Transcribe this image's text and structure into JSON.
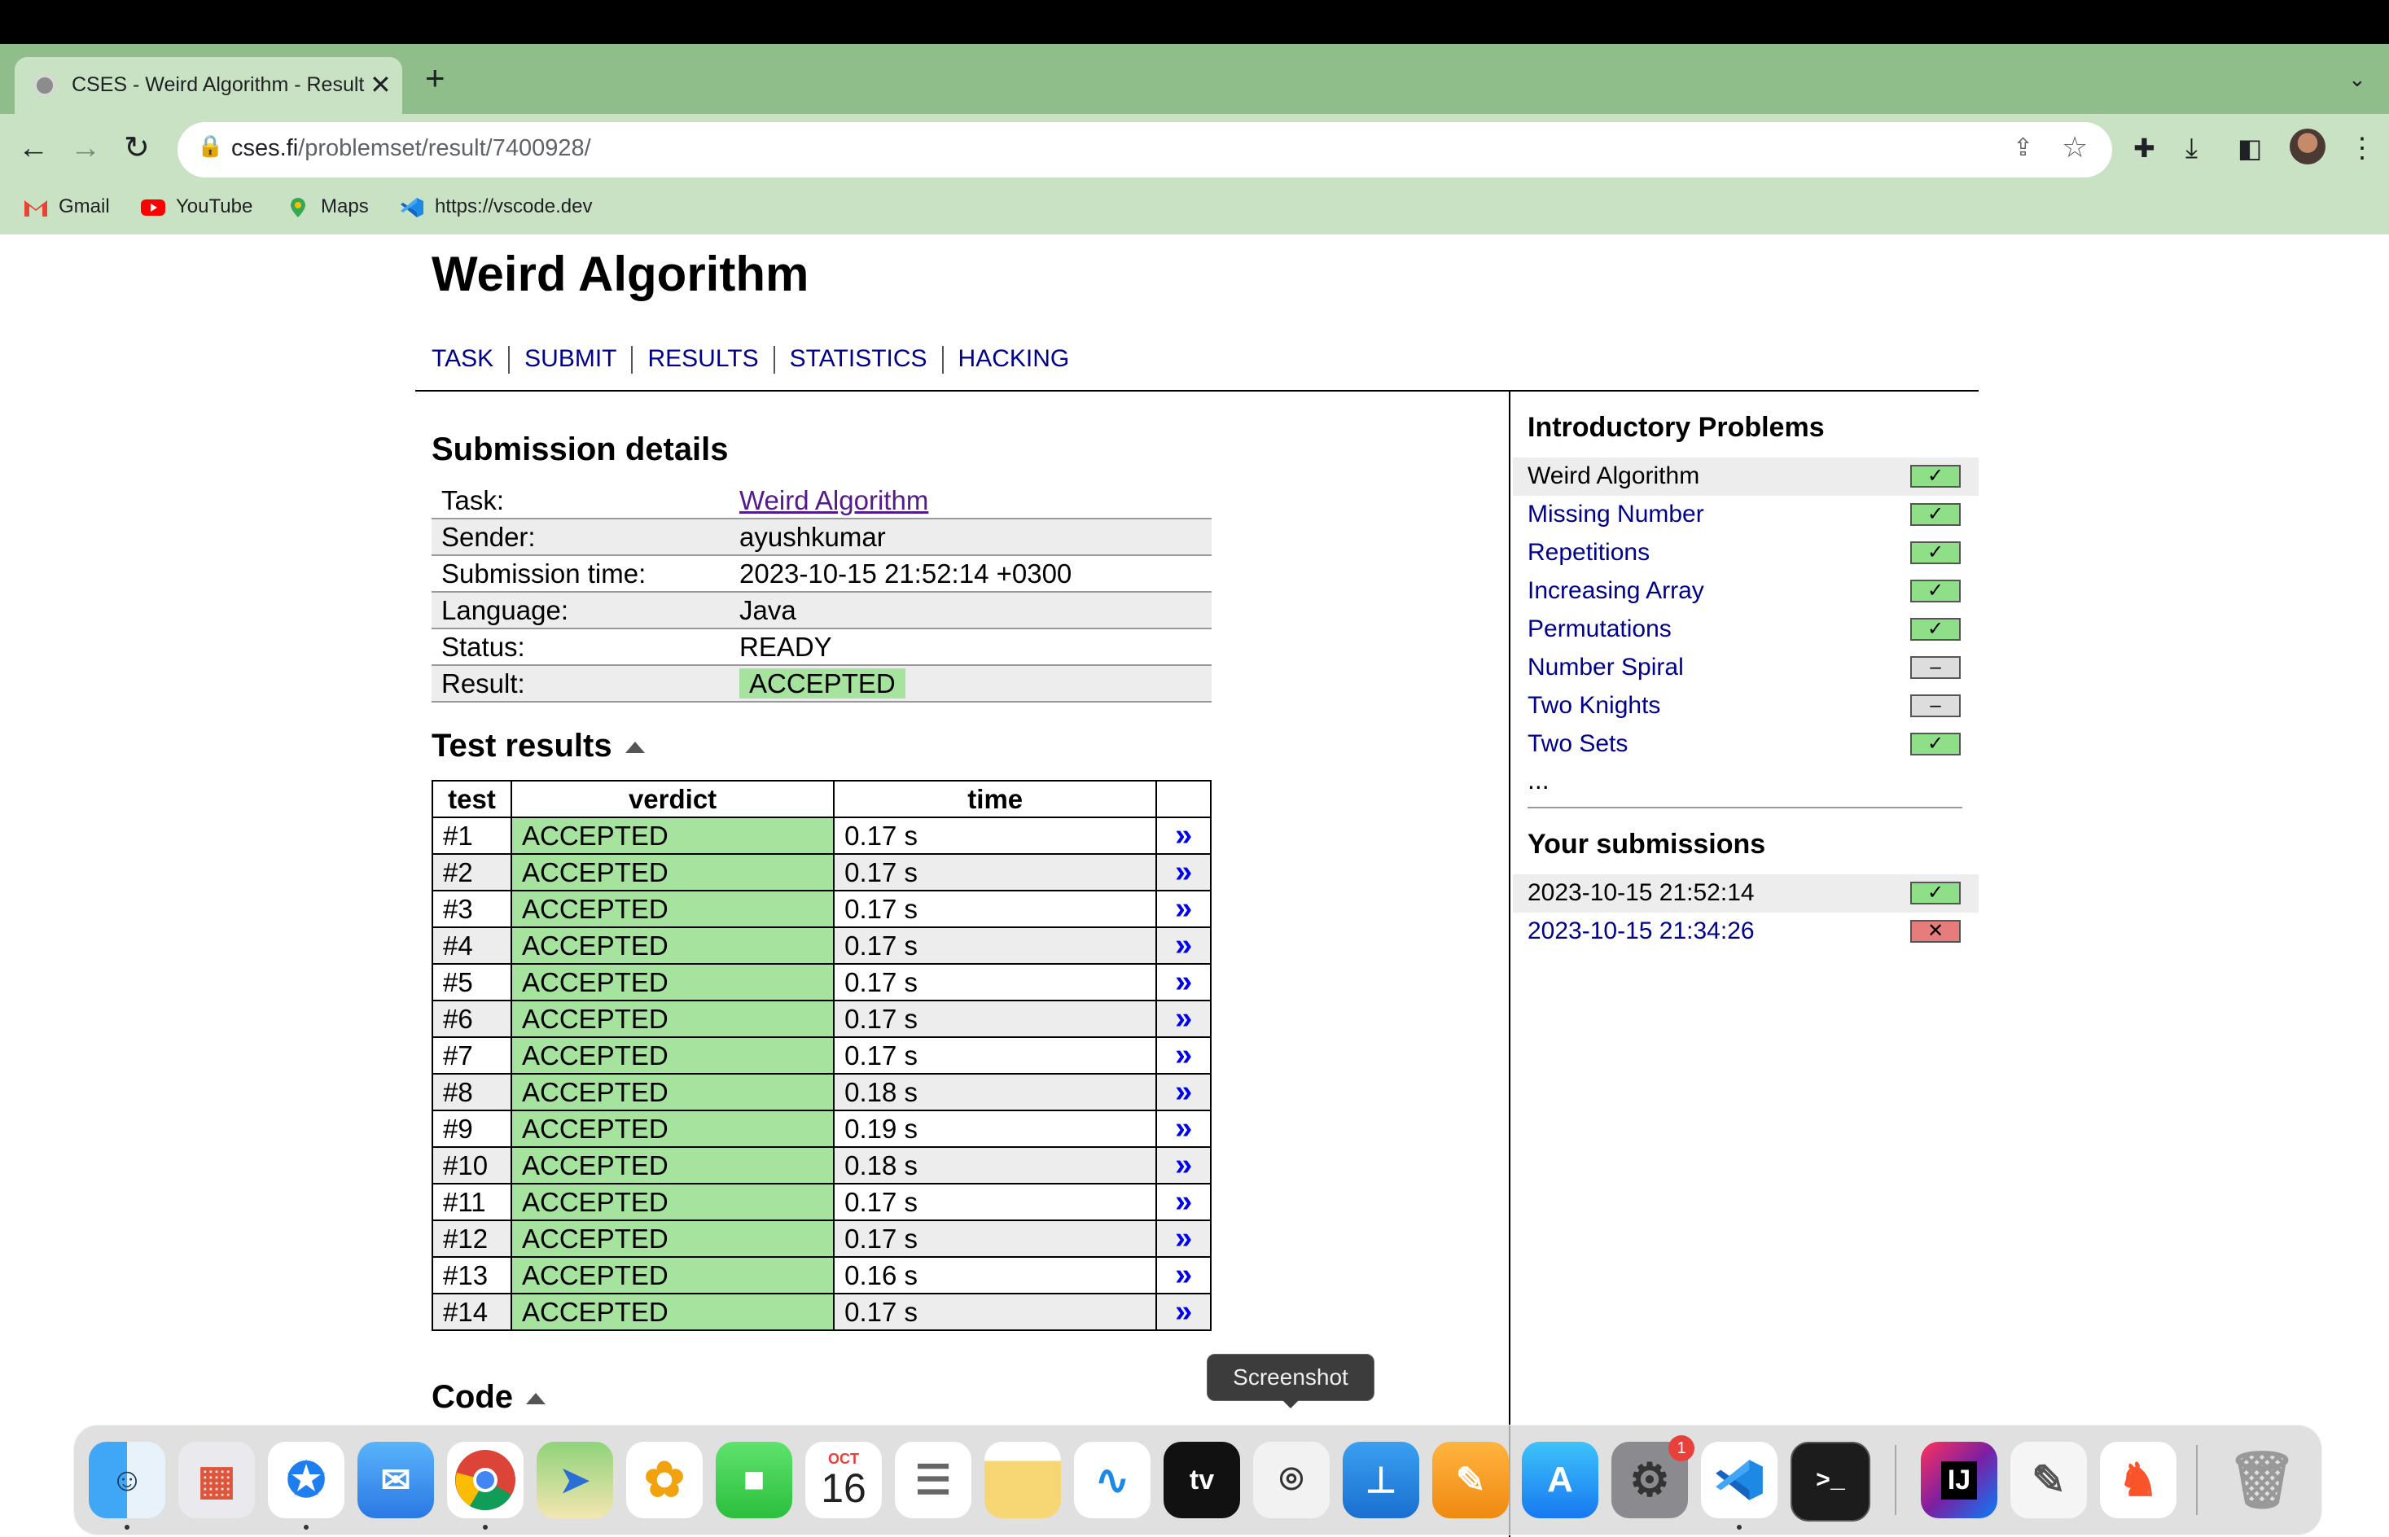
{
  "browser": {
    "tab_title": "CSES - Weird Algorithm - Results",
    "url_host": "cses.fi",
    "url_path": "/problemset/result/7400928/",
    "bookmarks": [
      "Gmail",
      "YouTube",
      "Maps",
      "https://vscode.dev"
    ]
  },
  "page": {
    "title": "Weird Algorithm",
    "nav": [
      "TASK",
      "SUBMIT",
      "RESULTS",
      "STATISTICS",
      "HACKING"
    ]
  },
  "submission": {
    "heading": "Submission details",
    "rows": [
      {
        "key": "Task:",
        "value": "Weird Algorithm"
      },
      {
        "key": "Sender:",
        "value": "ayushkumar"
      },
      {
        "key": "Submission time:",
        "value": "2023-10-15 21:52:14 +0300"
      },
      {
        "key": "Language:",
        "value": "Java"
      },
      {
        "key": "Status:",
        "value": "READY"
      },
      {
        "key": "Result:",
        "value": "ACCEPTED"
      }
    ]
  },
  "tests": {
    "heading": "Test results",
    "columns": [
      "test",
      "verdict",
      "time"
    ],
    "link_glyph": "»",
    "rows": [
      {
        "test": "#1",
        "verdict": "ACCEPTED",
        "time": "0.17 s"
      },
      {
        "test": "#2",
        "verdict": "ACCEPTED",
        "time": "0.17 s"
      },
      {
        "test": "#3",
        "verdict": "ACCEPTED",
        "time": "0.17 s"
      },
      {
        "test": "#4",
        "verdict": "ACCEPTED",
        "time": "0.17 s"
      },
      {
        "test": "#5",
        "verdict": "ACCEPTED",
        "time": "0.17 s"
      },
      {
        "test": "#6",
        "verdict": "ACCEPTED",
        "time": "0.17 s"
      },
      {
        "test": "#7",
        "verdict": "ACCEPTED",
        "time": "0.17 s"
      },
      {
        "test": "#8",
        "verdict": "ACCEPTED",
        "time": "0.18 s"
      },
      {
        "test": "#9",
        "verdict": "ACCEPTED",
        "time": "0.19 s"
      },
      {
        "test": "#10",
        "verdict": "ACCEPTED",
        "time": "0.18 s"
      },
      {
        "test": "#11",
        "verdict": "ACCEPTED",
        "time": "0.17 s"
      },
      {
        "test": "#12",
        "verdict": "ACCEPTED",
        "time": "0.17 s"
      },
      {
        "test": "#13",
        "verdict": "ACCEPTED",
        "time": "0.16 s"
      },
      {
        "test": "#14",
        "verdict": "ACCEPTED",
        "time": "0.17 s"
      }
    ]
  },
  "code": {
    "heading": "Code"
  },
  "sidebar": {
    "problems_heading": "Introductory Problems",
    "problems": [
      {
        "name": "Weird Algorithm",
        "status": "solved",
        "current": true
      },
      {
        "name": "Missing Number",
        "status": "solved"
      },
      {
        "name": "Repetitions",
        "status": "solved"
      },
      {
        "name": "Increasing Array",
        "status": "solved"
      },
      {
        "name": "Permutations",
        "status": "solved"
      },
      {
        "name": "Number Spiral",
        "status": "attempted-none"
      },
      {
        "name": "Two Knights",
        "status": "attempted-none"
      },
      {
        "name": "Two Sets",
        "status": "solved"
      }
    ],
    "more": "...",
    "submissions_heading": "Your submissions",
    "submissions": [
      {
        "time": "2023-10-15 21:52:14",
        "status": "accepted",
        "current": true
      },
      {
        "time": "2023-10-15 21:34:26",
        "status": "rejected"
      }
    ]
  },
  "tooltip": "Screenshot",
  "dock": {
    "calendar_month": "OCT",
    "calendar_day": "16",
    "settings_badge": "1",
    "apps": [
      "finder-icon",
      "launchpad-icon",
      "safari-icon",
      "mail-icon",
      "chrome-icon",
      "maps-icon",
      "photos-icon",
      "facetime-icon",
      "calendar-icon",
      "reminders-icon",
      "notes-icon",
      "freeform-icon",
      "apple-tv-icon",
      "screenshot-icon",
      "keynote-icon",
      "pages-icon",
      "app-store-icon",
      "system-settings-icon",
      "vscode-icon",
      "terminal-icon",
      "intellij-icon",
      "textedit-icon",
      "brave-icon",
      "trash-icon"
    ]
  },
  "colors": {
    "accepted_bg": "#a5e39f",
    "rejected_bg": "#e67c7c",
    "link": "#00008b",
    "tab_strip": "#8fbe8a",
    "toolbar": "#c9e2c4"
  }
}
